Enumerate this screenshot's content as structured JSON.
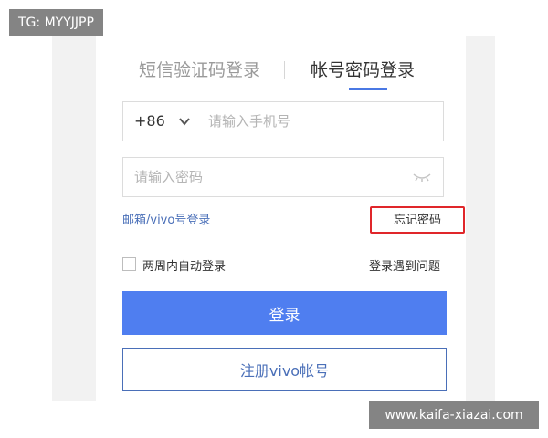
{
  "watermark": {
    "top": "TG: MYYJJPP",
    "bottom": "www.kaifa-xiazai.com"
  },
  "tabs": {
    "sms": "短信验证码登录",
    "password": "帐号密码登录",
    "active": "password"
  },
  "phone": {
    "country_code": "+86",
    "placeholder": "请输入手机号",
    "value": ""
  },
  "password": {
    "placeholder": "请输入密码",
    "value": ""
  },
  "links": {
    "email_login": "邮箱/vivo号登录",
    "forgot_password": "忘记密码",
    "login_trouble": "登录遇到问题"
  },
  "remember": {
    "label": "两周内自动登录",
    "checked": false
  },
  "buttons": {
    "login": "登录",
    "register": "注册vivo帐号"
  },
  "colors": {
    "accent": "#4f7ef0",
    "link": "#4a6fb8",
    "highlight_box": "#e0262a"
  }
}
